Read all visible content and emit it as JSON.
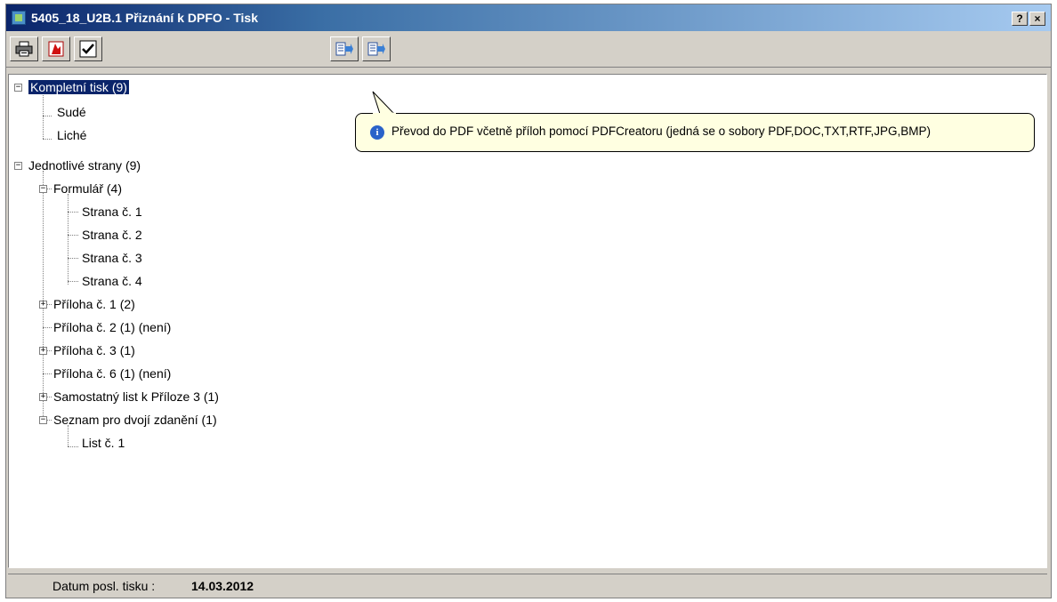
{
  "window": {
    "title": "5405_18_U2B.1 Přiznání k DPFO - Tisk",
    "help_button": "?",
    "close_button": "×"
  },
  "toolbar": {
    "buttons": [
      {
        "icon": "printer-icon"
      },
      {
        "icon": "pdf-export-icon"
      },
      {
        "icon": "checkmark-icon"
      },
      {
        "icon": "export-left-icon"
      },
      {
        "icon": "export-right-icon"
      }
    ]
  },
  "tree": {
    "complete_print": "Kompletní tisk (9)",
    "even": "Sudé",
    "odd": "Liché",
    "single_pages": "Jednotlivé strany (9)",
    "form": "Formulář (4)",
    "page1": "Strana č. 1",
    "page2": "Strana č. 2",
    "page3": "Strana č. 3",
    "page4": "Strana č. 4",
    "annex1": "Příloha č. 1 (2)",
    "annex2": "Příloha č. 2 (1) (není)",
    "annex3": "Příloha č. 3 (1)",
    "annex6": "Příloha č. 6 (1) (není)",
    "separate_sheet": "Samostatný list k Příloze 3 (1)",
    "double_tax": "Seznam pro dvojí zdanění (1)",
    "list1": "List č. 1"
  },
  "tooltip": {
    "text": "Převod do PDF včetně příloh pomocí PDFCreatoru (jedná se o sobory PDF,DOC,TXT,RTF,JPG,BMP)"
  },
  "status": {
    "label": "Datum posl. tisku :",
    "value": "14.03.2012"
  }
}
